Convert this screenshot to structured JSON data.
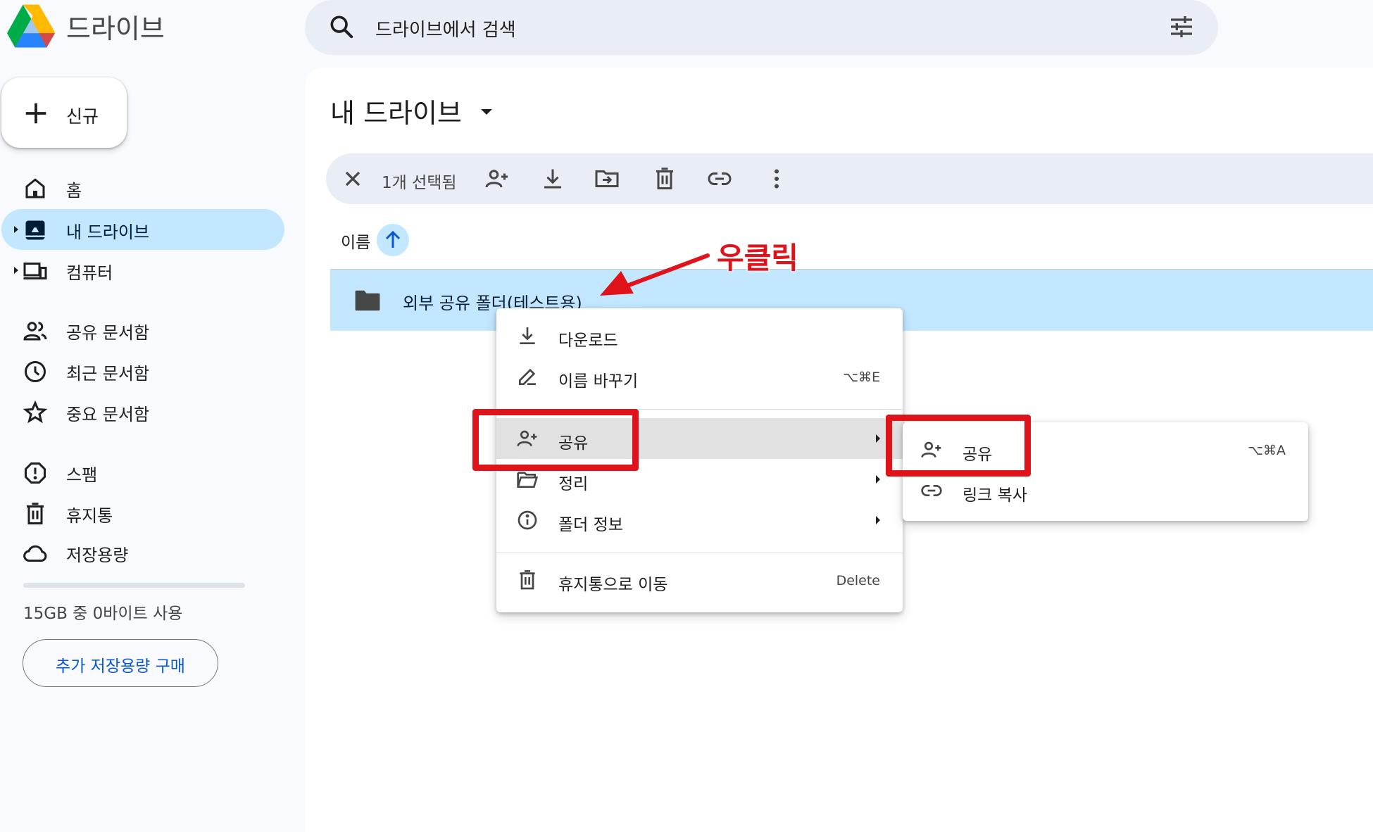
{
  "app": {
    "title": "드라이브",
    "logo_icon": "google-drive-logo"
  },
  "search": {
    "placeholder": "드라이브에서 검색",
    "icon": "search-icon",
    "options_icon": "tune-icon"
  },
  "sidebar": {
    "new_label": "신규",
    "items": [
      {
        "label": "홈",
        "icon": "home-icon",
        "active": false
      },
      {
        "label": "내 드라이브",
        "icon": "my-drive-icon",
        "active": true
      },
      {
        "label": "컴퓨터",
        "icon": "computers-icon",
        "active": false
      },
      {
        "label": "공유 문서함",
        "icon": "shared-icon",
        "active": false
      },
      {
        "label": "최근 문서함",
        "icon": "clock-icon",
        "active": false
      },
      {
        "label": "중요 문서함",
        "icon": "star-icon",
        "active": false
      },
      {
        "label": "스팸",
        "icon": "spam-icon",
        "active": false
      },
      {
        "label": "휴지통",
        "icon": "trash-icon",
        "active": false
      },
      {
        "label": "저장용량",
        "icon": "cloud-icon",
        "active": false
      }
    ],
    "storage_text": "15GB 중 0바이트 사용",
    "storage_used_fraction": 0,
    "buy_storage_label": "추가 저장용량 구매"
  },
  "main": {
    "title": "내 드라이브",
    "selection": {
      "count_label": "1개 선택됨"
    },
    "column_name": "이름",
    "files": [
      {
        "name": "외부 공유 폴더(테스트용)",
        "type": "folder",
        "selected": true
      }
    ]
  },
  "annotation": {
    "label": "우클릭",
    "color": "#e0131b"
  },
  "context_menu": {
    "items": [
      {
        "label": "다운로드",
        "icon": "download-icon",
        "shortcut": ""
      },
      {
        "label": "이름 바꾸기",
        "icon": "rename-icon",
        "shortcut": "⌥⌘E"
      },
      {
        "label": "공유",
        "icon": "person-add-icon",
        "shortcut": "",
        "submenu": true
      },
      {
        "label": "정리",
        "icon": "folder-open-icon",
        "shortcut": "",
        "submenu": true
      },
      {
        "label": "폴더 정보",
        "icon": "info-icon",
        "shortcut": "",
        "submenu": true
      },
      {
        "label": "휴지통으로 이동",
        "icon": "trash-icon",
        "shortcut": "Delete"
      }
    ]
  },
  "submenu": {
    "items": [
      {
        "label": "공유",
        "icon": "person-add-icon",
        "shortcut": "⌥⌘A"
      },
      {
        "label": "링크 복사",
        "icon": "link-icon",
        "shortcut": ""
      }
    ]
  },
  "colors": {
    "accent": "#0b57d0",
    "selection": "#c2e7ff",
    "highlight": "#e0131b"
  }
}
